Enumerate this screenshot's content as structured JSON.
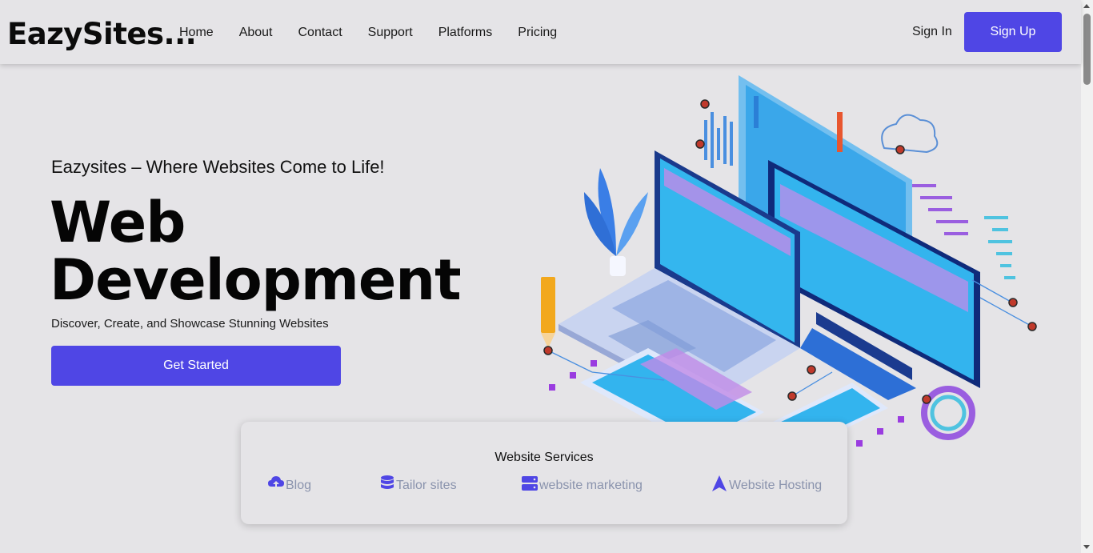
{
  "header": {
    "logo": "EazySites...",
    "nav": [
      "Home",
      "About",
      "Contact",
      "Support",
      "Platforms",
      "Pricing"
    ],
    "sign_in": "Sign In",
    "sign_up": "Sign Up"
  },
  "hero": {
    "tagline": "Eazysites – Where Websites Come to Life!",
    "title_line1": "Web",
    "title_line2": "Development",
    "subtitle": "Discover, Create, and Showcase Stunning Websites",
    "cta": "Get Started"
  },
  "services": {
    "title": "Website Services",
    "items": [
      {
        "label": "Blog",
        "icon": "cloud-upload-icon"
      },
      {
        "label": "Tailor sites",
        "icon": "database-icon"
      },
      {
        "label": "website marketing",
        "icon": "server-icon"
      },
      {
        "label": "Website Hosting",
        "icon": "arrow-up-icon"
      }
    ]
  },
  "colors": {
    "accent": "#4f46e5",
    "background": "#e5e4e7",
    "service_text": "#8a93ad"
  }
}
